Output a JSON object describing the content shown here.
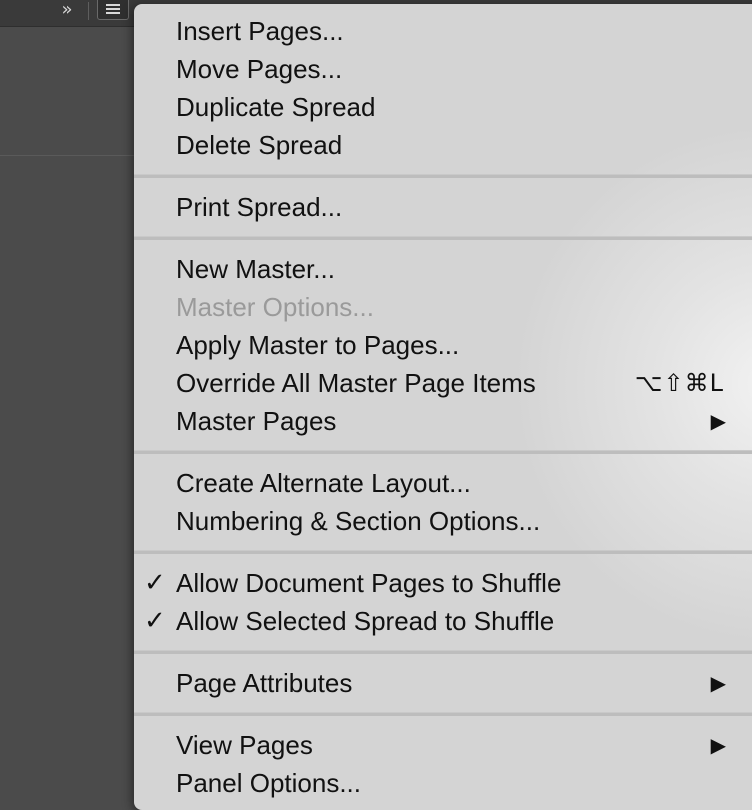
{
  "toolbar": {
    "collapse_glyph": "»",
    "menu_icon": "hamburger-menu-icon"
  },
  "menu": {
    "groups": [
      {
        "items": [
          {
            "label": "Insert Pages..."
          },
          {
            "label": "Move Pages..."
          },
          {
            "label": "Duplicate Spread"
          },
          {
            "label": "Delete Spread"
          }
        ]
      },
      {
        "items": [
          {
            "label": "Print Spread..."
          }
        ]
      },
      {
        "items": [
          {
            "label": "New Master..."
          },
          {
            "label": "Master Options...",
            "disabled": true
          },
          {
            "label": "Apply Master to Pages..."
          },
          {
            "label": "Override All Master Page Items",
            "shortcut": "⌥⇧⌘L"
          },
          {
            "label": "Master Pages",
            "submenu_arrow": "▶"
          }
        ]
      },
      {
        "items": [
          {
            "label": "Create Alternate Layout..."
          },
          {
            "label": "Numbering & Section Options..."
          }
        ]
      },
      {
        "items": [
          {
            "label": "Allow Document Pages to Shuffle",
            "check": "✓"
          },
          {
            "label": "Allow Selected Spread to Shuffle",
            "check": "✓"
          }
        ]
      },
      {
        "items": [
          {
            "label": "Page Attributes",
            "submenu_arrow": "▶"
          }
        ]
      },
      {
        "items": [
          {
            "label": "View Pages",
            "submenu_arrow": "▶"
          },
          {
            "label": "Panel Options..."
          }
        ]
      }
    ]
  }
}
